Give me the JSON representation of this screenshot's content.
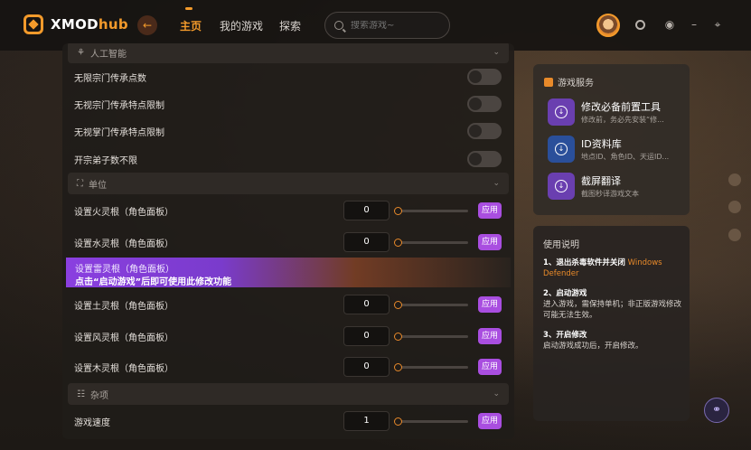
{
  "brand": {
    "logo_text_a": "XMOD",
    "logo_text_b": "hub"
  },
  "nav": {
    "back_icon": "back-arrow-icon",
    "items": [
      {
        "label": "主页",
        "active": true
      },
      {
        "label": "我的游戏",
        "active": false
      },
      {
        "label": "探索",
        "active": false
      }
    ]
  },
  "search": {
    "placeholder": "搜索游戏~"
  },
  "sections": {
    "ai": {
      "label": "人工智能"
    },
    "unit": {
      "label": "单位"
    },
    "misc": {
      "label": "杂项"
    }
  },
  "toggles": [
    {
      "label": "无限宗门传承点数"
    },
    {
      "label": "无视宗门传承特点限制"
    },
    {
      "label": "无视掌门传承特点限制"
    },
    {
      "label": "开宗弟子数不限"
    }
  ],
  "unit_rows": [
    {
      "label": "设置火灵根（角色面板）",
      "value": "0",
      "apply": "应用"
    },
    {
      "label": "设置水灵根（角色面板）",
      "value": "0",
      "apply": "应用"
    },
    {
      "label": "设置土灵根（角色面板）",
      "value": "0",
      "apply": "应用"
    },
    {
      "label": "设置风灵根（角色面板）",
      "value": "0",
      "apply": "应用"
    },
    {
      "label": "设置木灵根（角色面板）",
      "value": "0",
      "apply": "应用"
    }
  ],
  "overlay": {
    "row_label": "设置雷灵根（角色面板）",
    "hint": "点击“启动游戏”后即可使用此修改功能"
  },
  "misc_rows": [
    {
      "label": "游戏速度",
      "value": "1",
      "apply": "应用"
    }
  ],
  "services": {
    "title": "游戏服务",
    "items": [
      {
        "name": "修改必备前置工具",
        "desc": "修改前，务必先安装“修...",
        "color": "#6a3fb0"
      },
      {
        "name": "ID资料库",
        "desc": "地点ID、角色ID、天运ID...",
        "color": "#2a5ab0"
      },
      {
        "name": "截屏翻译",
        "desc": "截图秒译游戏文本",
        "color": "#6a3fb0"
      }
    ]
  },
  "help": {
    "title": "使用说明",
    "steps": [
      {
        "title": "1、退出杀毒软件并关闭",
        "accent": "Windows Defender",
        "body": ""
      },
      {
        "title": "2、启动游戏",
        "accent": "",
        "body": "进入游戏，需保持单机；非正版游戏修改可能无法生效。"
      },
      {
        "title": "3、开启修改",
        "accent": "",
        "body": "启动游戏成功后，开启修改。"
      }
    ]
  },
  "colors": {
    "accent": "#f39a2b",
    "apply": "#a94ee0"
  }
}
